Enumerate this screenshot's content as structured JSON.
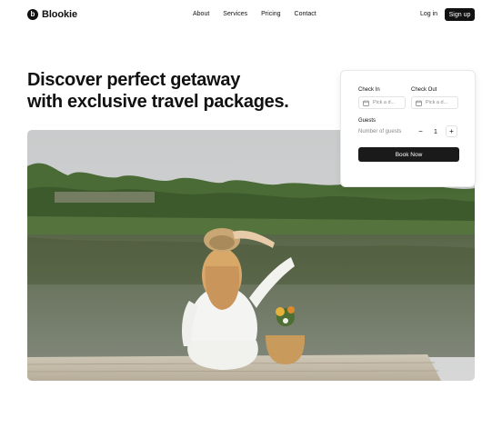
{
  "brand": {
    "logo_glyph": "b",
    "name": "Blookie"
  },
  "nav": {
    "items": [
      {
        "label": "About"
      },
      {
        "label": "Services"
      },
      {
        "label": "Pricing"
      },
      {
        "label": "Contact"
      }
    ],
    "login_label": "Log in",
    "signup_label": "Sign up"
  },
  "hero": {
    "title_line1": "Discover perfect getaway",
    "title_line2": "with exclusive travel packages."
  },
  "booking": {
    "check_in_label": "Check In",
    "check_in_placeholder": "Pick a d...",
    "check_out_label": "Check Out",
    "check_out_placeholder": "Pick a d...",
    "guests_label": "Guests",
    "guests_text": "Number of guests",
    "decrement_glyph": "−",
    "increment_glyph": "+",
    "guest_count": "1",
    "book_label": "Book Now"
  },
  "colors": {
    "primary": "#111111",
    "border": "#e3e3e3",
    "muted_text": "#888888"
  },
  "icons": [
    "calendar-icon",
    "minus-icon",
    "plus-icon"
  ]
}
